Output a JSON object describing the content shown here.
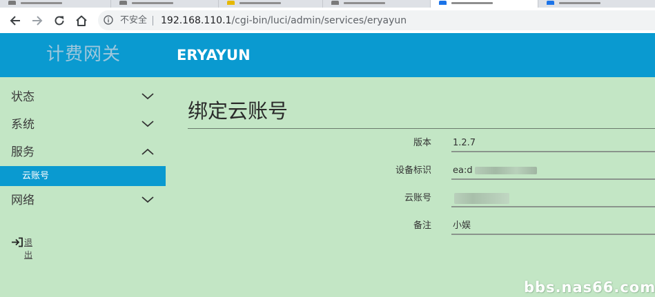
{
  "browser": {
    "security_label": "不安全",
    "url_host": "192.168.110.1",
    "url_path": "/cgi-bin/luci/admin/services/eryayun"
  },
  "header": {
    "brand": "计费网关",
    "app_title": "ERYAYUN"
  },
  "sidebar": {
    "items": [
      {
        "label": "状态",
        "expanded": false
      },
      {
        "label": "系统",
        "expanded": false
      },
      {
        "label": "服务",
        "expanded": true
      },
      {
        "label": "网络",
        "expanded": false
      }
    ],
    "active_subitem": "云账号",
    "logout_label": "退出"
  },
  "main": {
    "title": "绑定云账号",
    "fields": [
      {
        "label": "版本",
        "value": "1.2.7"
      },
      {
        "label": "设备标识",
        "value": "ea:d"
      },
      {
        "label": "云账号",
        "value": ""
      },
      {
        "label": "备注",
        "value": "小娱"
      }
    ]
  },
  "watermark": "bbs.nas66.com",
  "colors": {
    "header_bg": "#0a9ad0",
    "page_bg": "#c3e6c5",
    "brand_text": "#9ec7dc"
  },
  "icons": [
    "back-arrow-icon",
    "forward-arrow-icon",
    "reload-icon",
    "home-icon",
    "info-icon",
    "chevron-down-icon",
    "chevron-up-icon",
    "logout-icon"
  ]
}
